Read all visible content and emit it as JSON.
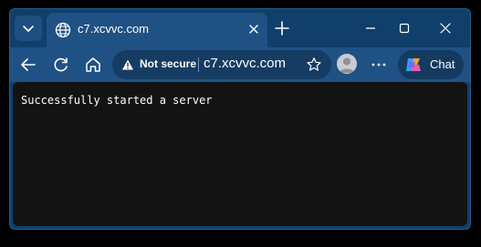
{
  "tab": {
    "title": "c7.xcvvc.com",
    "icon": "globe-icon"
  },
  "address_bar": {
    "security_label": "Not secure",
    "security_icon": "warning-icon",
    "url": "c7.xcvvc.com"
  },
  "toolbar": {
    "chat_label": "Chat"
  },
  "page": {
    "message": "Successfully started a server"
  },
  "colors": {
    "window_frame": "#113f6b",
    "toolbar": "#1f5185",
    "content_background": "#131313",
    "text": "#ffffff"
  }
}
